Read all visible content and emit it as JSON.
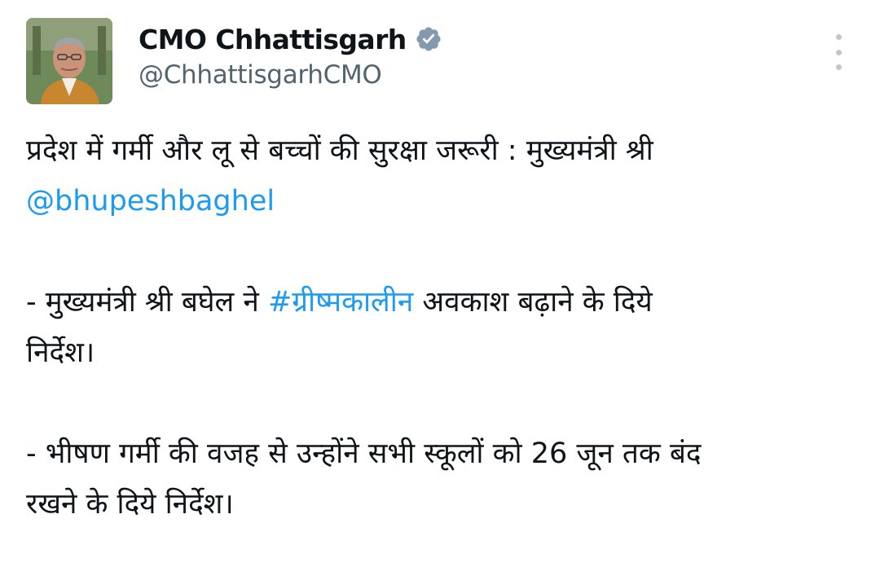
{
  "author": {
    "display_name": "CMO Chhattisgarh",
    "handle": "@ChhattisgarhCMO",
    "verified_icon": "verified-badge-icon",
    "badge_color": "#829aab"
  },
  "menu": {
    "icon": "more-vertical-icon"
  },
  "tweet": {
    "line1": "प्रदेश में गर्मी और लू से बच्चों की सुरक्षा जरूरी : मुख्यमंत्री श्री",
    "mention": "@bhupeshbaghel",
    "bullet1_prefix": "- मुख्यमंत्री श्री बघेल ने ",
    "hashtag": "#ग्रीष्मकालीन",
    "bullet1_suffix": " अवकाश बढ़ाने के दिये",
    "bullet1_line2": "निर्देश।",
    "bullet2_line1": "- भीषण गर्मी की वजह से उन्होंने सभी स्कूलों को 26 जून तक बंद",
    "bullet2_line2": "रखने के दिये निर्देश।",
    "link_color": "#1d9bf0"
  }
}
